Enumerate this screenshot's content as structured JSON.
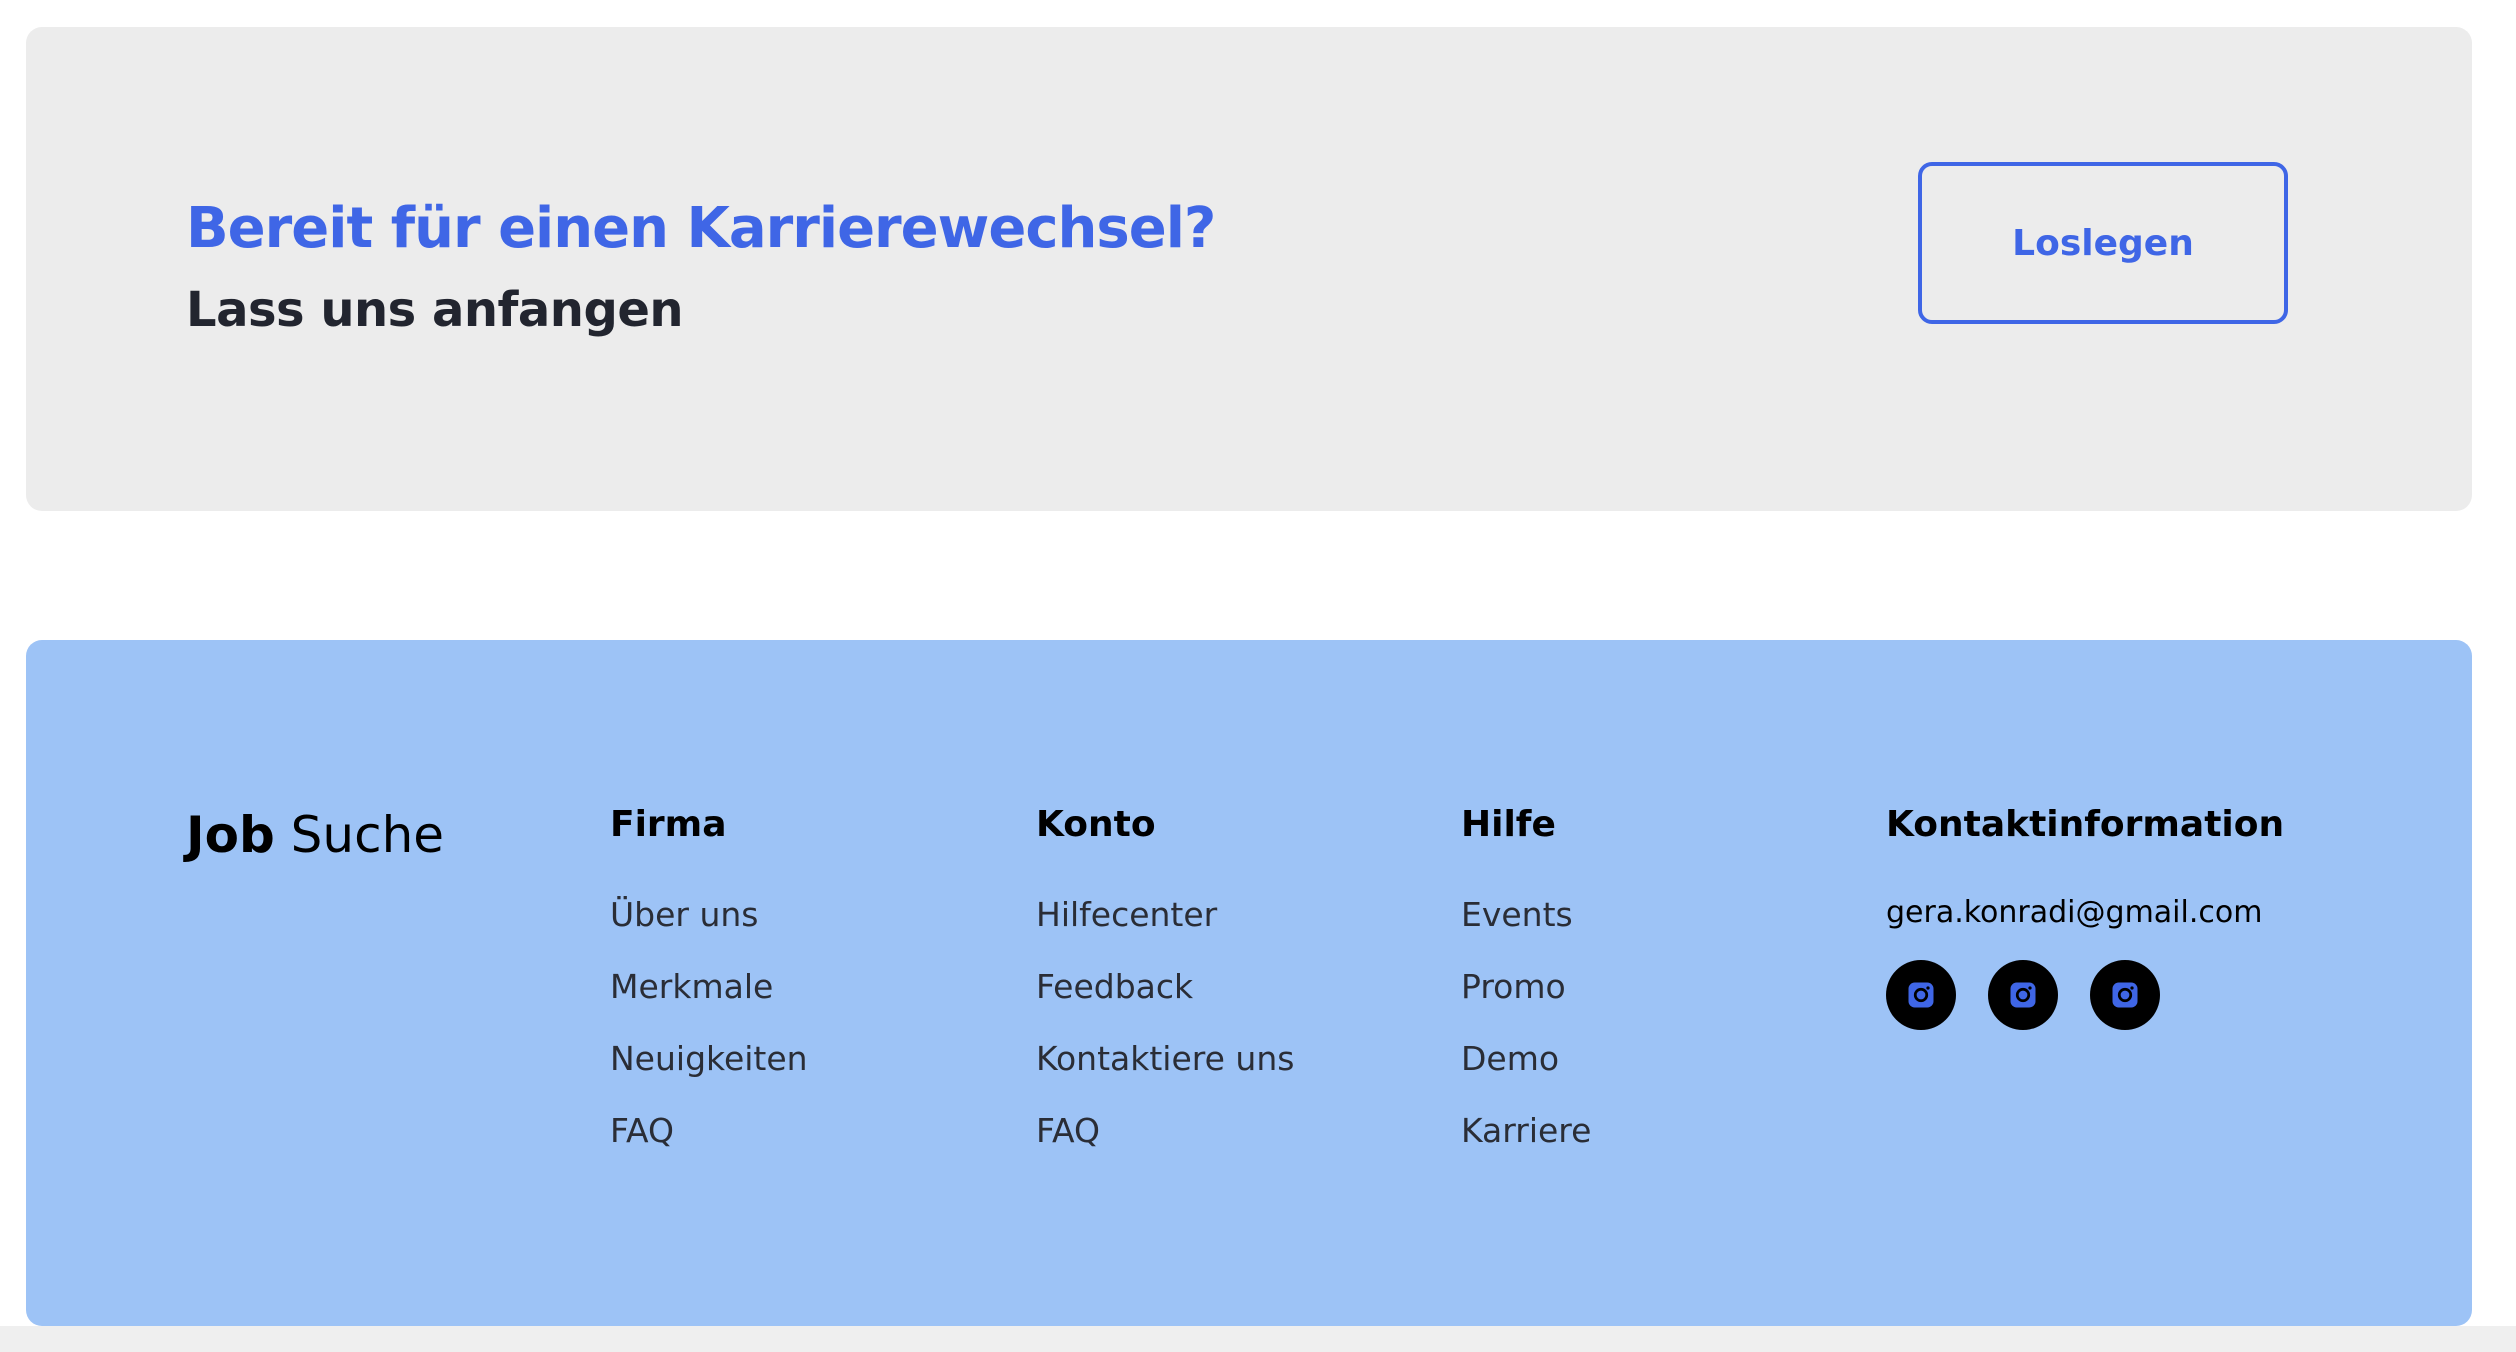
{
  "cta": {
    "title": "Bereit für einen Karrierewechsel?",
    "subtitle": "Lass uns anfangen",
    "button_label": "Loslegen"
  },
  "footer": {
    "logo": {
      "bold": "Job",
      "light": "Suche"
    },
    "columns": [
      {
        "heading": "Firma",
        "links": [
          "Über uns",
          "Merkmale",
          "Neuigkeiten",
          "FAQ"
        ]
      },
      {
        "heading": "Konto",
        "links": [
          "Hilfecenter",
          "Feedback",
          "Kontaktiere uns",
          "FAQ"
        ]
      },
      {
        "heading": "Hilfe",
        "links": [
          "Events",
          "Promo",
          "Demo",
          "Karriere"
        ]
      }
    ],
    "contact": {
      "heading": "Kontaktinformation",
      "email": "gera.konradi@gmail.com",
      "socials": [
        "instagram-icon",
        "instagram-icon",
        "instagram-icon"
      ]
    }
  },
  "colors": {
    "accent": "#3f66e6",
    "cta_background": "#ececec",
    "footer_background": "#9dc3f6",
    "social_background": "#000000"
  }
}
